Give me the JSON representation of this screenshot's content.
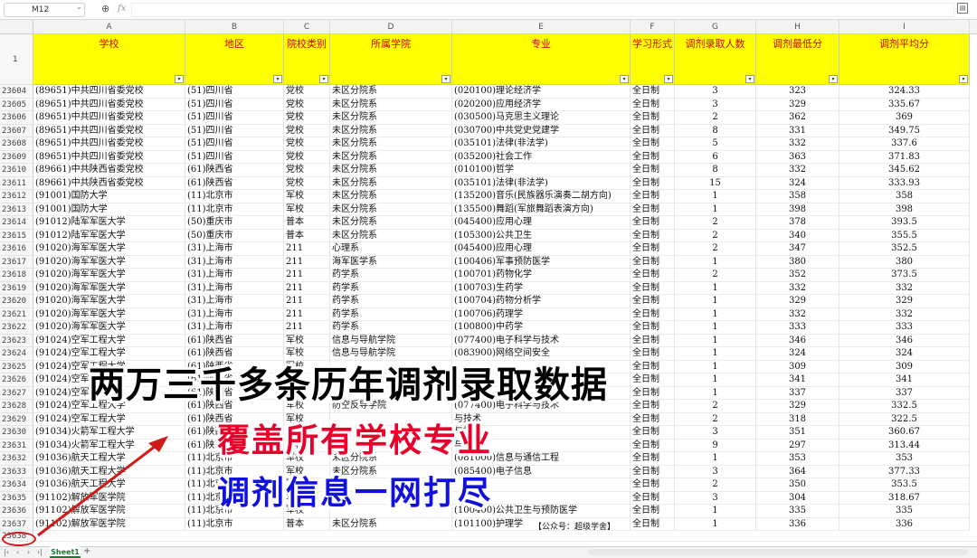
{
  "formula_bar": {
    "name_box": "M12",
    "fx": "fx"
  },
  "columns": [
    "A",
    "B",
    "C",
    "D",
    "E",
    "F",
    "G",
    "H",
    "I"
  ],
  "header_row_number": "1",
  "headers": [
    "学校",
    "地区",
    "院校类别",
    "所属学院",
    "专业",
    "学习形式",
    "调剂录取人数",
    "调剂最低分",
    "调剂平均分"
  ],
  "rows": [
    [
      "23604",
      "(89651)中共四川省委党校",
      "(51)四川省",
      "党校",
      "未区分院系",
      "(020100)理论经济学",
      "全日制",
      "3",
      "323",
      "324.33"
    ],
    [
      "23605",
      "(89651)中共四川省委党校",
      "(51)四川省",
      "党校",
      "未区分院系",
      "(020200)应用经济学",
      "全日制",
      "3",
      "329",
      "335.67"
    ],
    [
      "23606",
      "(89651)中共四川省委党校",
      "(51)四川省",
      "党校",
      "未区分院系",
      "(030500)马克思主义理论",
      "全日制",
      "2",
      "362",
      "369"
    ],
    [
      "23607",
      "(89651)中共四川省委党校",
      "(51)四川省",
      "党校",
      "未区分院系",
      "(030700)中共党史党建学",
      "全日制",
      "8",
      "331",
      "349.75"
    ],
    [
      "23608",
      "(89651)中共四川省委党校",
      "(51)四川省",
      "党校",
      "未区分院系",
      "(035101)法律(非法学)",
      "全日制",
      "5",
      "332",
      "337.6"
    ],
    [
      "23609",
      "(89651)中共四川省委党校",
      "(51)四川省",
      "党校",
      "未区分院系",
      "(035200)社会工作",
      "全日制",
      "6",
      "363",
      "371.83"
    ],
    [
      "23610",
      "(89661)中共陕西省委党校",
      "(61)陕西省",
      "党校",
      "未区分院系",
      "(010100)哲学",
      "全日制",
      "8",
      "332",
      "345.62"
    ],
    [
      "23611",
      "(89661)中共陕西省委党校",
      "(61)陕西省",
      "党校",
      "未区分院系",
      "(035101)法律(非法学)",
      "全日制",
      "15",
      "324",
      "333.93"
    ],
    [
      "23612",
      "(91001)国防大学",
      "(11)北京市",
      "军校",
      "未区分院系",
      "(135200)音乐(民族器乐演奏二胡方向)",
      "全日制",
      "1",
      "358",
      "358"
    ],
    [
      "23613",
      "(91001)国防大学",
      "(11)北京市",
      "军校",
      "未区分院系",
      "(135500)舞蹈(军旅舞蹈表演方向)",
      "全日制",
      "1",
      "398",
      "398"
    ],
    [
      "23614",
      "(91012)陆军军医大学",
      "(50)重庆市",
      "普本",
      "未区分院系",
      "(045400)应用心理",
      "全日制",
      "2",
      "378",
      "393.5"
    ],
    [
      "23615",
      "(91012)陆军军医大学",
      "(50)重庆市",
      "普本",
      "未区分院系",
      "(105300)公共卫生",
      "全日制",
      "2",
      "340",
      "355.5"
    ],
    [
      "23616",
      "(91020)海军军医大学",
      "(31)上海市",
      "211",
      "心理系",
      "(045400)应用心理",
      "全日制",
      "2",
      "347",
      "352.5"
    ],
    [
      "23617",
      "(91020)海军军医大学",
      "(31)上海市",
      "211",
      "海军医学系",
      "(100406)军事预防医学",
      "全日制",
      "1",
      "380",
      "380"
    ],
    [
      "23618",
      "(91020)海军军医大学",
      "(31)上海市",
      "211",
      "药学系",
      "(100701)药物化学",
      "全日制",
      "2",
      "352",
      "373.5"
    ],
    [
      "23619",
      "(91020)海军军医大学",
      "(31)上海市",
      "211",
      "药学系",
      "(100703)生药学",
      "全日制",
      "1",
      "332",
      "332"
    ],
    [
      "23620",
      "(91020)海军军医大学",
      "(31)上海市",
      "211",
      "药学系",
      "(100704)药物分析学",
      "全日制",
      "1",
      "329",
      "329"
    ],
    [
      "23621",
      "(91020)海军军医大学",
      "(31)上海市",
      "211",
      "药学系",
      "(100706)药理学",
      "全日制",
      "1",
      "332",
      "332"
    ],
    [
      "23622",
      "(91020)海军军医大学",
      "(31)上海市",
      "211",
      "药学系",
      "(100800)中药学",
      "全日制",
      "1",
      "333",
      "333"
    ],
    [
      "23623",
      "(91024)空军工程大学",
      "(61)陕西省",
      "军校",
      "信息与导航学院",
      "(077400)电子科学与技术",
      "全日制",
      "1",
      "346",
      "346"
    ],
    [
      "23624",
      "(91024)空军工程大学",
      "(61)陕西省",
      "军校",
      "信息与导航学院",
      "(083900)网络空间安全",
      "全日制",
      "1",
      "324",
      "324"
    ],
    [
      "23625",
      "(91024)空军工程大学",
      "(61)陕西省",
      "军校",
      "",
      "",
      "全日制",
      "1",
      "309",
      "309"
    ],
    [
      "23626",
      "(91024)空军工程大学",
      "(61)陕西省",
      "军校",
      "",
      "",
      "全日制",
      "1",
      "341",
      "341"
    ],
    [
      "23627",
      "(91024)空军工程大学",
      "(61)陕西省",
      "军校",
      "",
      "",
      "全日制",
      "1",
      "337",
      "337"
    ],
    [
      "23628",
      "(91024)空军工程大学",
      "(61)陕西省",
      "军校",
      "防空反导学院",
      "(077400)电子科学与技术",
      "全日制",
      "2",
      "329",
      "332.5"
    ],
    [
      "23629",
      "(91024)空军工程大学",
      "(61)陕西省",
      "军校",
      "",
      "与技术",
      "全日制",
      "2",
      "318",
      "322.5"
    ],
    [
      "23630",
      "(91034)火箭军工程大学",
      "(61)陕西省",
      "军校",
      "",
      "与技术",
      "全日制",
      "3",
      "351",
      "360.67"
    ],
    [
      "23631",
      "(91034)火箭军工程大学",
      "(61)陕西省",
      "军校",
      "",
      "与技术",
      "全日制",
      "9",
      "297",
      "313.44"
    ],
    [
      "23632",
      "(91036)航天工程大学",
      "(11)北京市",
      "军校",
      "未区分院系",
      "(081000)信息与通信工程",
      "全日制",
      "1",
      "353",
      "353"
    ],
    [
      "23633",
      "(91036)航天工程大学",
      "(11)北京市",
      "军校",
      "未区分院系",
      "(085400)电子信息",
      "全日制",
      "3",
      "364",
      "377.33"
    ],
    [
      "23634",
      "(91036)航天工程大学",
      "(11)北京市",
      "军校",
      "",
      "",
      "全日制",
      "2",
      "350",
      "353.5"
    ],
    [
      "23635",
      "(91102)解放军医学院",
      "(11)北京市",
      "军校",
      "",
      "",
      "全日制",
      "3",
      "304",
      "318.67"
    ],
    [
      "23636",
      "(91102)解放军医学院",
      "(11)北京市",
      "军校",
      "",
      "(100400)公共卫生与预防医学",
      "全日制",
      "1",
      "335",
      "335"
    ],
    [
      "23637",
      "(91102)解放军医学院",
      "(11)北京市",
      "普本",
      "未区分院系",
      "(101100)护理学",
      "全日制",
      "1",
      "336",
      "336"
    ]
  ],
  "last_row_number": "23638",
  "sheet_tab": "Sheet1",
  "overlay": {
    "line1": "两万三千多条历年调剂录取数据",
    "line2": "覆盖所有学校专业",
    "line3": "调剂信息一网打尽",
    "watermark": "【公众号：超级学舍】"
  },
  "colors": {
    "header_fill": "#ffff00",
    "header_text": "#d00000",
    "line2": "#e8002a",
    "line3": "#1010e0",
    "annotation": "#d01a1a",
    "sheet_tab": "#1a7a32"
  }
}
